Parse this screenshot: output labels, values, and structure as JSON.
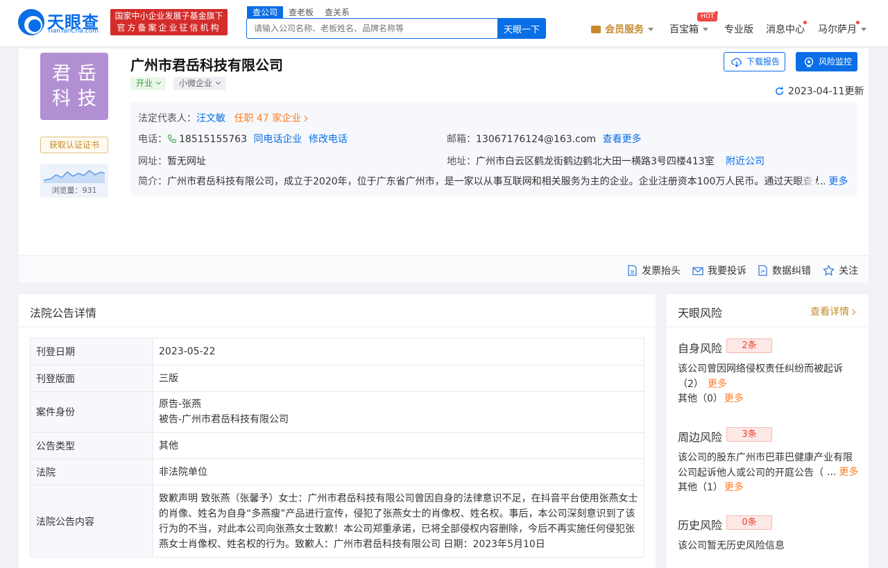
{
  "header": {
    "logo_name": "天眼查",
    "logo_sub": "TianYanCha.com",
    "badge_line1": "国家中小企业发展子基金旗下",
    "badge_line2": "官方备案企业征信机构",
    "search_tabs": [
      "查公司",
      "查老板",
      "查关系"
    ],
    "search_placeholder": "请输入公司名称、老板姓名、品牌名称等",
    "search_button": "天眼一下",
    "nav": {
      "vip": "会员服务",
      "toolbox": "百宝箱",
      "hot": "HOT",
      "pro": "专业版",
      "messages": "消息中心",
      "user": "马尔萨月"
    }
  },
  "company": {
    "logo_line1": "君岳",
    "logo_line2": "科技",
    "cert_button": "获取认证证书",
    "views_label": "浏览量：931",
    "name": "广州市君岳科技有限公司",
    "status_tag": "开业",
    "size_tag": "小微企业",
    "download_button": "下载报告",
    "monitor_button": "风险监控",
    "updated": "2023-04-11更新",
    "legal_rep_label": "法定代表人：",
    "legal_rep": "汪文敏",
    "positions": "任职 47 家企业",
    "phone_label": "电话：",
    "phone": "18515155763",
    "same_phone": "同电话企业",
    "edit_phone": "修改电话",
    "email_label": "邮箱：",
    "email": "13067176124@163.com",
    "view_more": "查看更多",
    "website_label": "网址：",
    "website": "暂无网址",
    "address_label": "地址：",
    "address": "广州市白云区鹤龙街鹤边鹤北大田一横路3号四楼413室",
    "nearby": "附近公司",
    "intro_label": "简介：",
    "intro": "广州市君岳科技有限公司，成立于2020年，位于广东省广州市，是一家以从事互联网和相关服务为主的企业。企业注册资本100万人民币。通过天眼查大数据分析",
    "intro_dots": "...",
    "more": "更多"
  },
  "actions": [
    "发票抬头",
    "我要投诉",
    "数据纠错",
    "关注"
  ],
  "notice": {
    "title": "法院公告详情",
    "rows": [
      {
        "key": "刊登日期",
        "value": [
          "2023-05-22"
        ]
      },
      {
        "key": "刊登版面",
        "value": [
          "三版"
        ]
      },
      {
        "key": "案件身份",
        "value": [
          "原告-张燕",
          "被告-广州市君岳科技有限公司"
        ]
      },
      {
        "key": "公告类型",
        "value": [
          "其他"
        ]
      },
      {
        "key": "法院",
        "value": [
          "非法院单位"
        ]
      },
      {
        "key": "法院公告内容",
        "value": [
          "致歉声明 致张燕（张馨予）女士：广州市君岳科技有限公司曾因自身的法律意识不足，在抖音平台使用张燕女士的肖像、姓名为自身“多燕瘦”产品进行宣传，侵犯了张燕女士的肖像权、姓名权。事后，本公司深刻意识到了该行为的不当，对此本公司向张燕女士致歉！本公司郑重承诺，已将全部侵权内容删除，今后不再实施任何侵犯张燕女士肖像权、姓名权的行为。致歉人：广州市君岳科技有限公司 日期：2023年5月10日"
        ]
      }
    ]
  },
  "risk": {
    "title": "天眼风险",
    "view_detail": "查看详情",
    "sections": [
      {
        "title": "自身风险",
        "count": "2条",
        "text": "该公司曾因网络侵权责任纠纷而被起诉（2）",
        "more": "更多",
        "other": "其他（0）",
        "other_more": "更多"
      },
      {
        "title": "周边风险",
        "count": "3条",
        "text": "该公司的股东广州市巴菲巴健康产业有限公司起诉他人或公司的开庭公告（",
        "dots": "...",
        "more": "更多",
        "other": "其他（1）",
        "other_more": "更多"
      },
      {
        "title": "历史风险",
        "count": "0条",
        "text": "该公司暂无历史风险信息"
      }
    ]
  },
  "colors": {
    "brand": "#0a6ee6",
    "vip_gold": "#c58a2b",
    "risk_red": "#e6463a",
    "logo_purple": "#b28fd3",
    "badge_red": "#d32c2b"
  }
}
